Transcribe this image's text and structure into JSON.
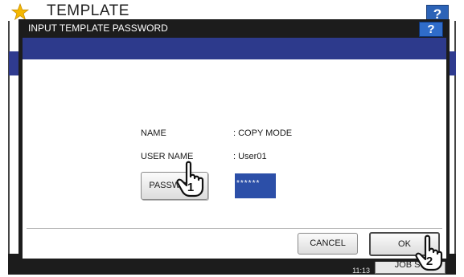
{
  "background": {
    "title": "TEMPLATE",
    "help_label": "?",
    "datetime": {
      "date": "",
      "time": "11:13"
    },
    "job_status_label": "JOB ST"
  },
  "dialog": {
    "title": "INPUT TEMPLATE PASSWORD",
    "help_label": "?",
    "name_label": "NAME",
    "name_value": ": COPY MODE",
    "user_name_label": "USER NAME",
    "user_name_value": ": User01",
    "password_button_label": "PASSWORD",
    "password_field_value": "******",
    "cancel_label": "CANCEL",
    "ok_label": "OK"
  },
  "callouts": {
    "step_1": "1",
    "step_2": "2"
  },
  "colors": {
    "accent_blue": "#2d3a8c",
    "field_blue": "#2c4fa8",
    "help_blue": "#2f6cc9",
    "dark_frame": "#1c1c1c",
    "star_yellow": "#f5b800"
  },
  "icons": {
    "star": "star-icon",
    "hand_pointer": "hand-pointer-icon"
  }
}
